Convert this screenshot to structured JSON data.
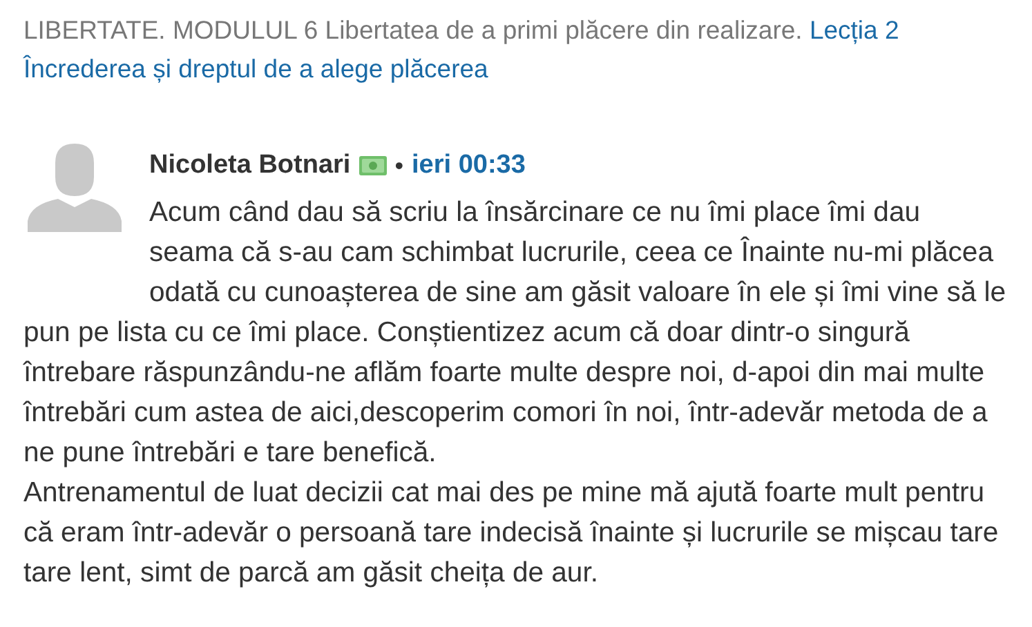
{
  "breadcrumb": {
    "text": "LIBERTATE. MODULUL 6 Libertatea de a primi plăcere din realizare.",
    "links": [
      "Lecția 2",
      "Încrederea și dreptul de a alege plăcerea"
    ]
  },
  "comment": {
    "author": "Nicoleta Botnari",
    "separator": "•",
    "time": "ieri 00:33",
    "paragraphs": [
      "Acum când dau să scriu la însărcinare ce nu îmi place îmi dau seama că s-au cam schimbat lucrurile, ceea ce Înainte nu-mi plăcea odată cu cunoașterea de sine am găsit valoare în ele și îmi vine să le pun pe lista cu ce îmi place. Conștientizez acum că doar dintr-o singură întrebare răspunzându-ne aflăm foarte multe despre noi, d-apoi din mai multe întrebări cum astea de aici,descoperim comori în noi, într-adevăr metoda de a ne pune întrebări e tare benefică.",
      "Antrenamentul de luat decizii cat mai des pe mine mă ajută foarte mult pentru că eram într-adevăr o persoană tare indecisă înainte și lucrurile se mișcau tare tare lent, simt de parcă am găsit cheița de aur."
    ]
  }
}
